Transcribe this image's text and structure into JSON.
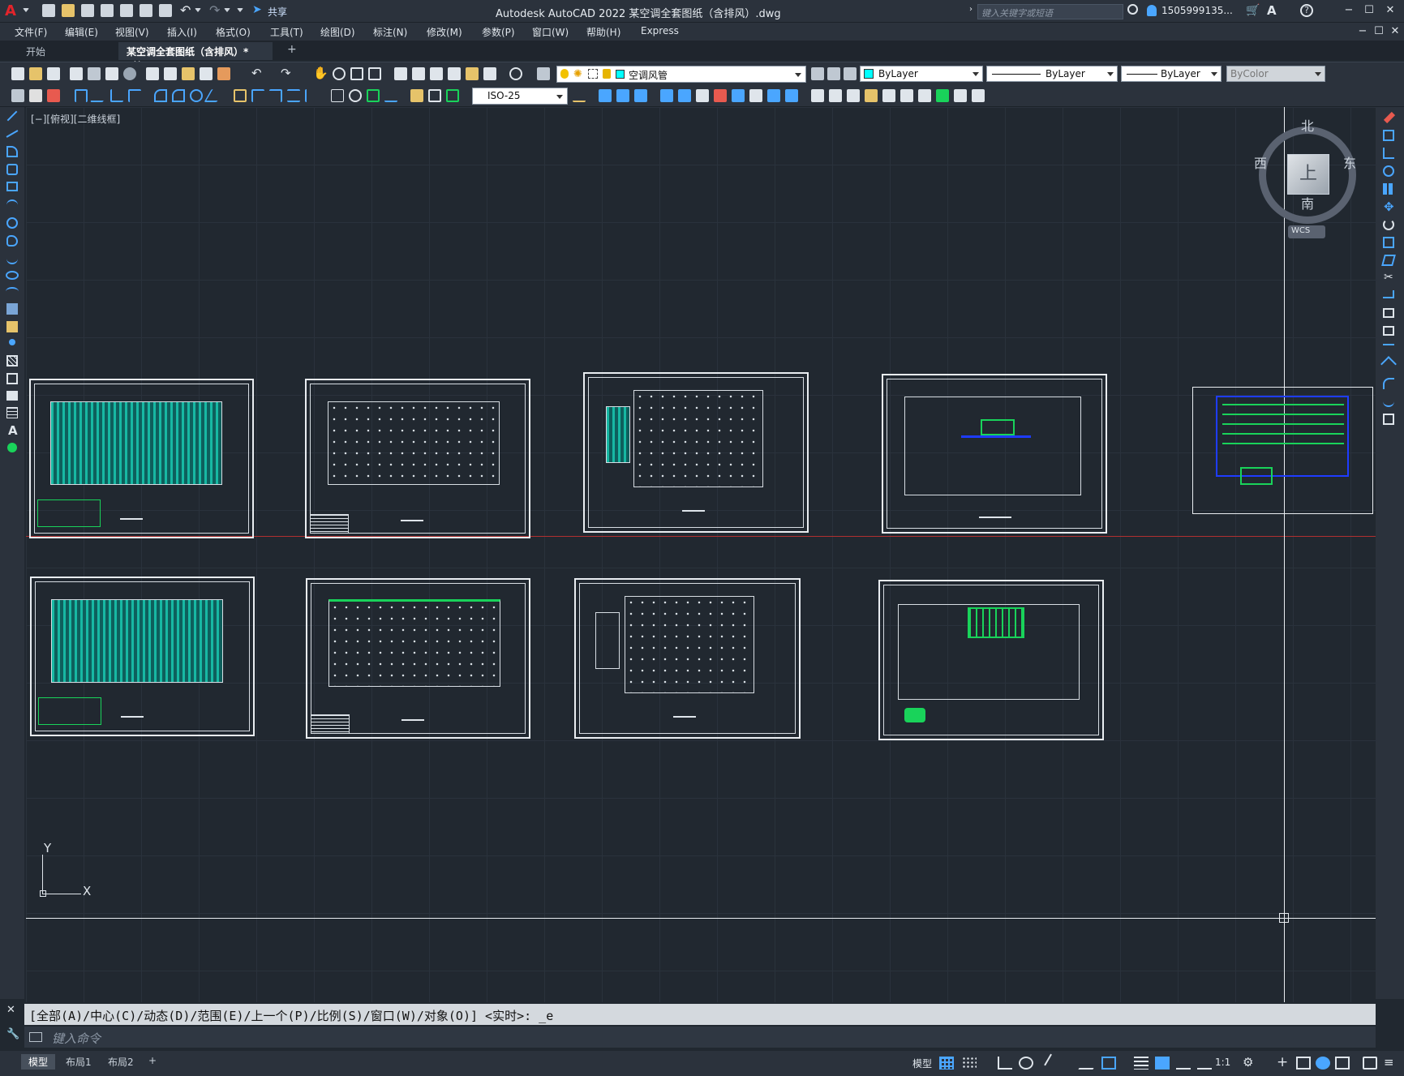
{
  "app": {
    "logo": "A",
    "title": "Autodesk AutoCAD 2022    某空调全套图纸（含排风）.dwg",
    "share_label": "共享",
    "search_placeholder": "键入关键字或短语",
    "user": "1505999135...",
    "window_controls": [
      "−",
      "☐",
      "✕"
    ],
    "doc_controls": [
      "−",
      "☐",
      "✕"
    ]
  },
  "menu": [
    "文件(F)",
    "编辑(E)",
    "视图(V)",
    "插入(I)",
    "格式(O)",
    "工具(T)",
    "绘图(D)",
    "标注(N)",
    "修改(M)",
    "参数(P)",
    "窗口(W)",
    "帮助(H)",
    "Express"
  ],
  "tabs": {
    "start": "开始",
    "doc": "某空调全套图纸（含排风）*",
    "close": "✕",
    "add": "+"
  },
  "toolbar": {
    "layer_name": "空调风管",
    "color": "ByLayer",
    "linetype": "ByLayer",
    "lineweight": "ByLayer",
    "plotstyle": "ByColor",
    "dimstyle": "ISO-25"
  },
  "viewport": {
    "label": "[−][俯视][二维线框]"
  },
  "viewcube": {
    "north": "北",
    "south": "南",
    "east": "东",
    "west": "西",
    "face": "上",
    "wcs": "WCS"
  },
  "ucs": {
    "x": "X",
    "y": "Y"
  },
  "command": {
    "history": "[全部(A)/中心(C)/动态(D)/范围(E)/上一个(P)/比例(S)/窗口(W)/对象(O)] <实时>: _e",
    "placeholder": "键入命令"
  },
  "layouts": [
    "模型",
    "布局1",
    "布局2",
    "+"
  ],
  "status": {
    "model": "模型",
    "scale": "1:1"
  },
  "colors": {
    "accent": "#0a7ad6",
    "cad_green": "#19d35a",
    "cad_cyan": "#17b8a3",
    "cad_blue": "#1e3cff",
    "canvas_bg": "#212830",
    "axis_red": "#b03030"
  }
}
